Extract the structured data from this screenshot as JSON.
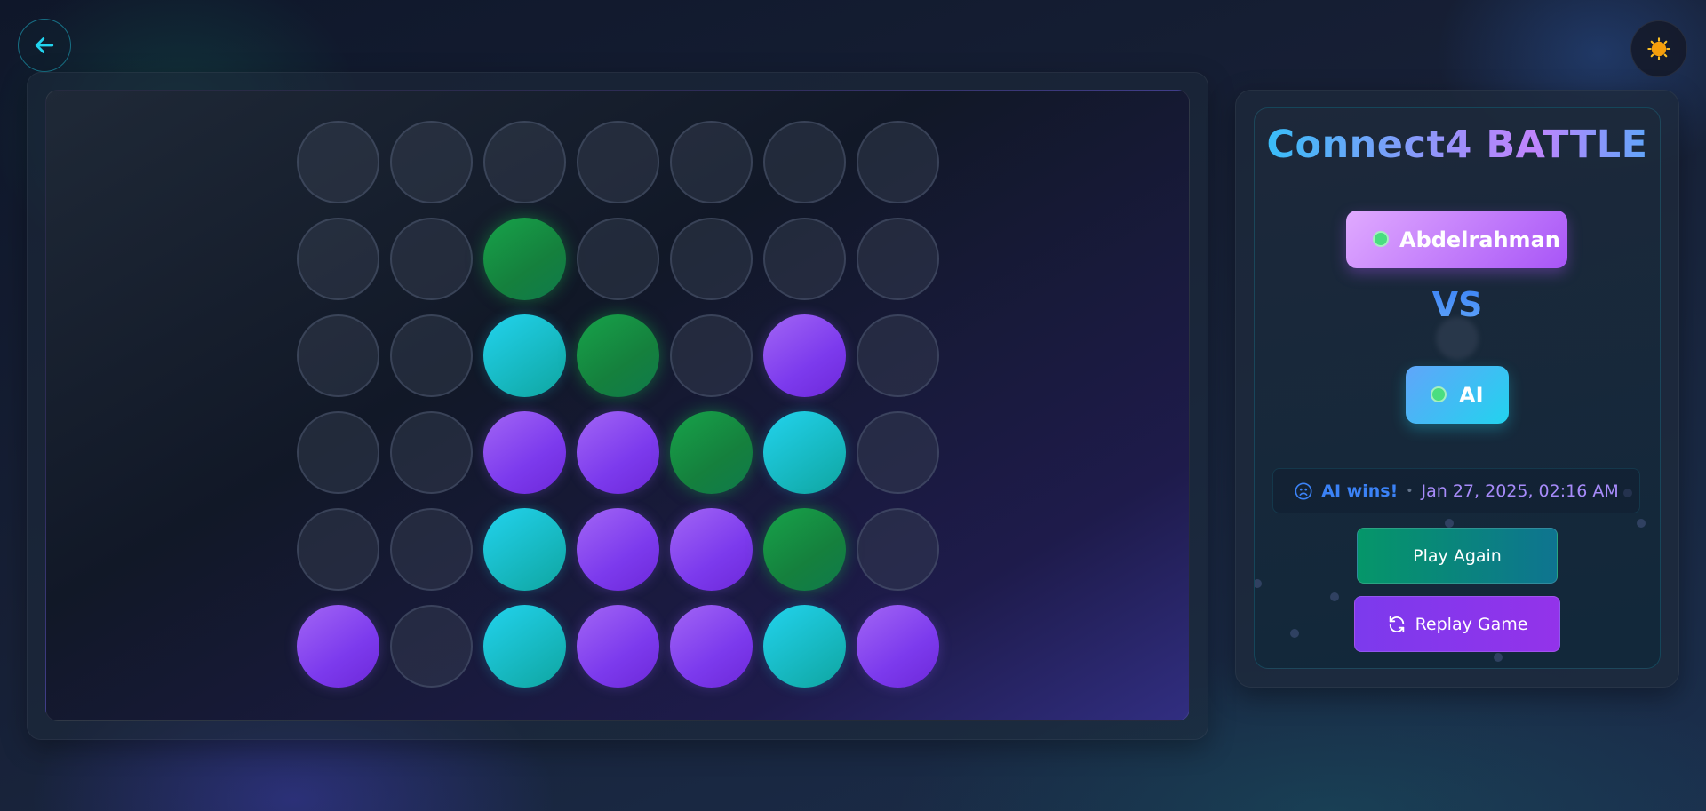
{
  "header": {
    "back_icon": "arrow-left-icon",
    "theme_icon": "sun-icon"
  },
  "board": {
    "rows": 6,
    "columns": 7,
    "cells": [
      [
        "empty",
        "empty",
        "empty",
        "empty",
        "empty",
        "empty",
        "empty"
      ],
      [
        "empty",
        "empty",
        "green",
        "empty",
        "empty",
        "empty",
        "empty"
      ],
      [
        "empty",
        "empty",
        "cyan",
        "green",
        "empty",
        "purple",
        "empty"
      ],
      [
        "empty",
        "empty",
        "purple",
        "purple",
        "green",
        "cyan",
        "empty"
      ],
      [
        "empty",
        "empty",
        "cyan",
        "purple",
        "purple",
        "green",
        "empty"
      ],
      [
        "purple",
        "empty",
        "cyan",
        "purple",
        "purple",
        "cyan",
        "purple"
      ]
    ],
    "colors": {
      "player1": "#8b5cf6",
      "player2": "#22d3ee",
      "winning": "#16a34a"
    }
  },
  "panel": {
    "title": "Connect4 BATTLE",
    "player1": {
      "name": "Abdelrahman",
      "status_color": "#4ade80"
    },
    "vs_label": "VS",
    "player2": {
      "name": "AI",
      "status_color": "#4ade80"
    },
    "result": {
      "icon": "sad-face-icon",
      "winner_text": "AI wins!",
      "separator": "•",
      "date": "Jan 27, 2025, 02:16 AM"
    },
    "play_again_label": "Play Again",
    "replay_label": "Replay Game",
    "replay_icon": "refresh-icon"
  }
}
